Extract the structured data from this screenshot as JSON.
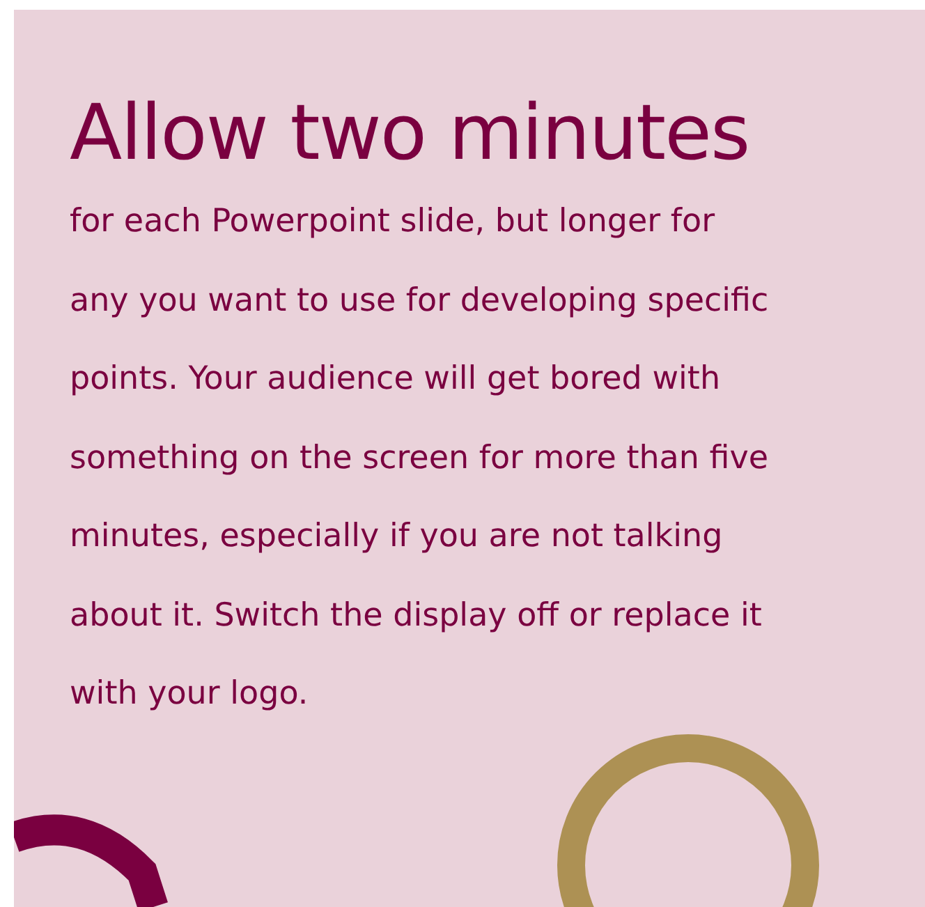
{
  "card": {
    "title": "Allow two minutes",
    "body": "for each Powerpoint slide, but longer for any you want to use for developing specific points. Your audience will get bored with something on the screen for more than five minutes, especially if you are not talking about it. Switch the display off or replace it with your logo."
  }
}
